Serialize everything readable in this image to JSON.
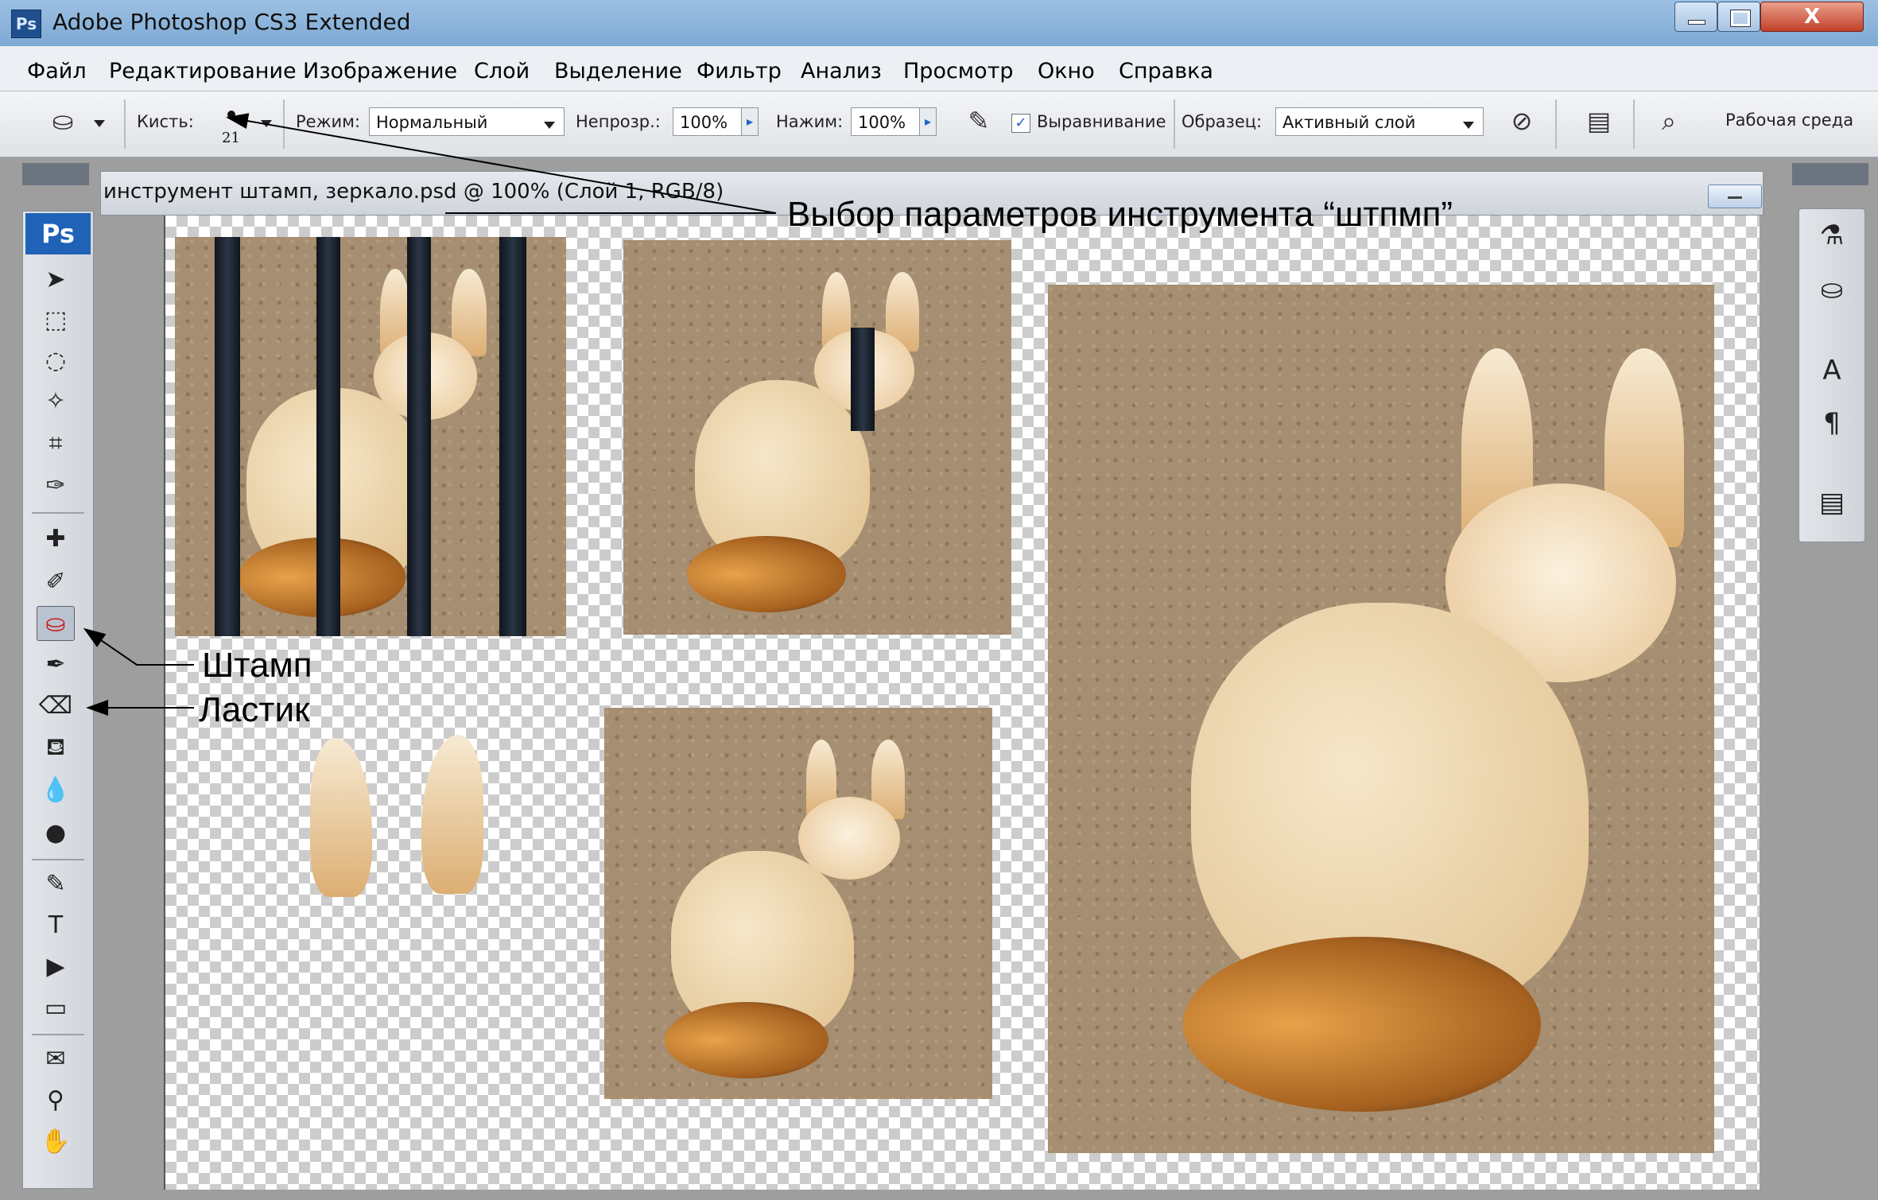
{
  "window": {
    "app_title": "Adobe Photoshop CS3 Extended",
    "logo": "Ps",
    "close_glyph": "X"
  },
  "menu": [
    "Файл",
    "Редактирование",
    "Изображение",
    "Слой",
    "Выделение",
    "Фильтр",
    "Анализ",
    "Просмотр",
    "Окно",
    "Справка"
  ],
  "options": {
    "brush_label": "Кисть:",
    "brush_size": "21",
    "mode_label": "Режим:",
    "mode_value": "Нормальный",
    "opacity_label": "Непрозр.:",
    "opacity_value": "100%",
    "flow_label": "Нажим:",
    "flow_value": "100%",
    "aligned_label": "Выравнивание",
    "sample_label": "Образец:",
    "sample_value": "Активный слой",
    "workspace_label": "Рабочая среда"
  },
  "document": {
    "title": "инструмент штамп, зеркало.psd @ 100% (Слой 1, RGB/8)"
  },
  "toolbox": {
    "logo": "Ps"
  },
  "annotations": {
    "options": "Выбор параметров инструмента “штпмп”",
    "stamp": "Штамп",
    "eraser": "Ластик"
  },
  "colors": {
    "title_bar": "#8fb5dc",
    "workspace": "#9e9e9e",
    "accent": "#1f62b8"
  }
}
